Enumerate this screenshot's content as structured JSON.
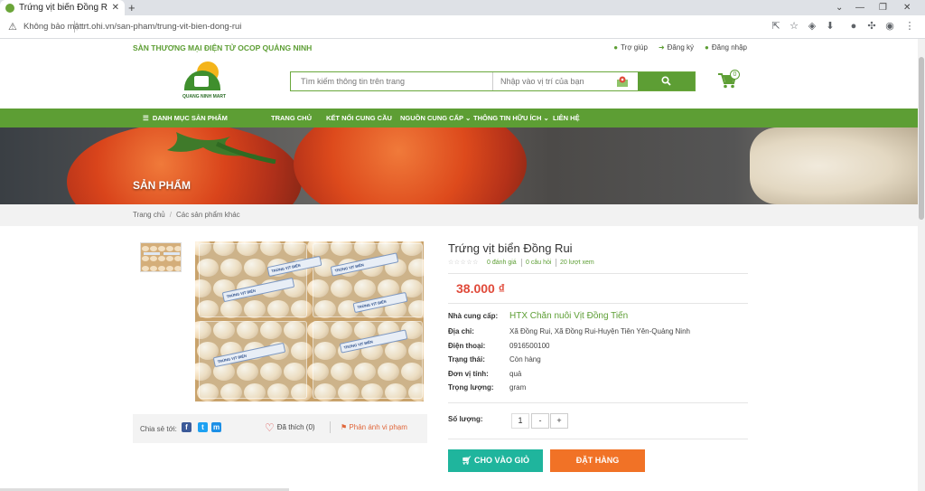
{
  "browser": {
    "tab_title": "Trứng vịt biển Đồng Rui - Q...",
    "tab_close": "✕",
    "new_tab": "+",
    "security": "Không bảo mật",
    "url": "trt.ohi.vn/san-pham/trung-vit-bien-dong-rui"
  },
  "site": {
    "top_note": "SÀN THƯƠNG MẠI ĐIỆN TỬ OCOP QUẢNG NINH",
    "help": "Trợ giúp",
    "register": "Đăng ký",
    "login": "Đăng nhập",
    "logo_text": "QUANG NINH MART",
    "search_placeholder": "Tìm kiếm thông tin trên trang",
    "location_placeholder": "Nhập vào vị trí của bạn",
    "cart_count": "0"
  },
  "nav": {
    "categories": "DANH MỤC SẢN PHẨM",
    "home": "TRANG CHỦ",
    "connect": "KẾT NỐI CUNG CẦU",
    "supply": "NGUỒN CUNG CẤP",
    "info": "THÔNG TIN HỮU ÍCH",
    "contact": "LIÊN HỆ"
  },
  "banner": {
    "title": "SẢN PHẨM"
  },
  "breadcrumb": {
    "home": "Trang chủ",
    "sep": "/",
    "current": "Các sản phẩm khác"
  },
  "product": {
    "title": "Trứng vịt biển Đồng Rui",
    "stars": "☆☆☆☆☆",
    "reviews": "0 đánh giá",
    "questions": "0 câu hỏi",
    "views": "20 lượt xem",
    "price": "38.000 ₫",
    "label_text": "TRỨNG VỊT BIỂN",
    "fields": [
      {
        "label": "Nhà cung cấp:",
        "value": "HTX Chăn nuôi Vịt Đồng Tiến"
      },
      {
        "label": "Địa chỉ:",
        "value": "Xã Đồng Rui, Xã Đồng Rui-Huyện Tiên Yên-Quảng Ninh"
      },
      {
        "label": "Điện thoại:",
        "value": "0916500100"
      },
      {
        "label": "Trạng thái:",
        "value": "Còn hàng"
      },
      {
        "label": "Đơn vị tính:",
        "value": "quả"
      },
      {
        "label": "Trọng lượng:",
        "value": "gram"
      }
    ],
    "qty_label": "Số lượng:",
    "qty_value": "1",
    "minus": "-",
    "plus": "+",
    "add_to_cart": "CHO VÀO GIỎ",
    "order": "ĐẶT HÀNG"
  },
  "share": {
    "label": "Chia sẻ tới:",
    "like": "Đã thích (0)",
    "report": "Phản ánh vi phạm"
  },
  "colors": {
    "brand_green": "#5d9e34",
    "price_red": "#e04a3a",
    "cart_teal": "#1fb59d",
    "order_orange": "#f17226"
  }
}
